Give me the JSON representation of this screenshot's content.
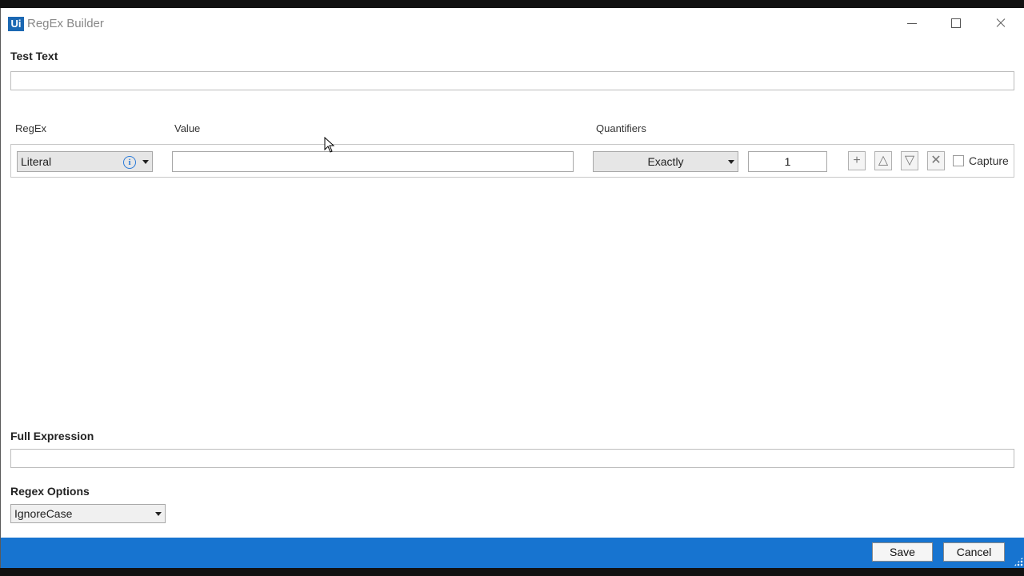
{
  "window": {
    "title": "RegEx Builder",
    "logo_text": "Ui"
  },
  "test_text": {
    "label": "Test Text",
    "value": ""
  },
  "columns": {
    "regex": "RegEx",
    "value": "Value",
    "quantifiers": "Quantifiers"
  },
  "row": {
    "regex_type": "Literal",
    "value": "",
    "quantifier": "Exactly",
    "count": "1",
    "capture_label": "Capture",
    "capture_checked": false
  },
  "icons": {
    "info": "info-icon",
    "add": "plus-icon",
    "up": "triangle-up-icon",
    "down": "triangle-down-icon",
    "delete": "close-icon"
  },
  "full_expression": {
    "label": "Full Expression",
    "value": ""
  },
  "regex_options": {
    "label": "Regex Options",
    "selected": "IgnoreCase"
  },
  "footer": {
    "save_label": "Save",
    "cancel_label": "Cancel",
    "color": "#1774d0"
  }
}
